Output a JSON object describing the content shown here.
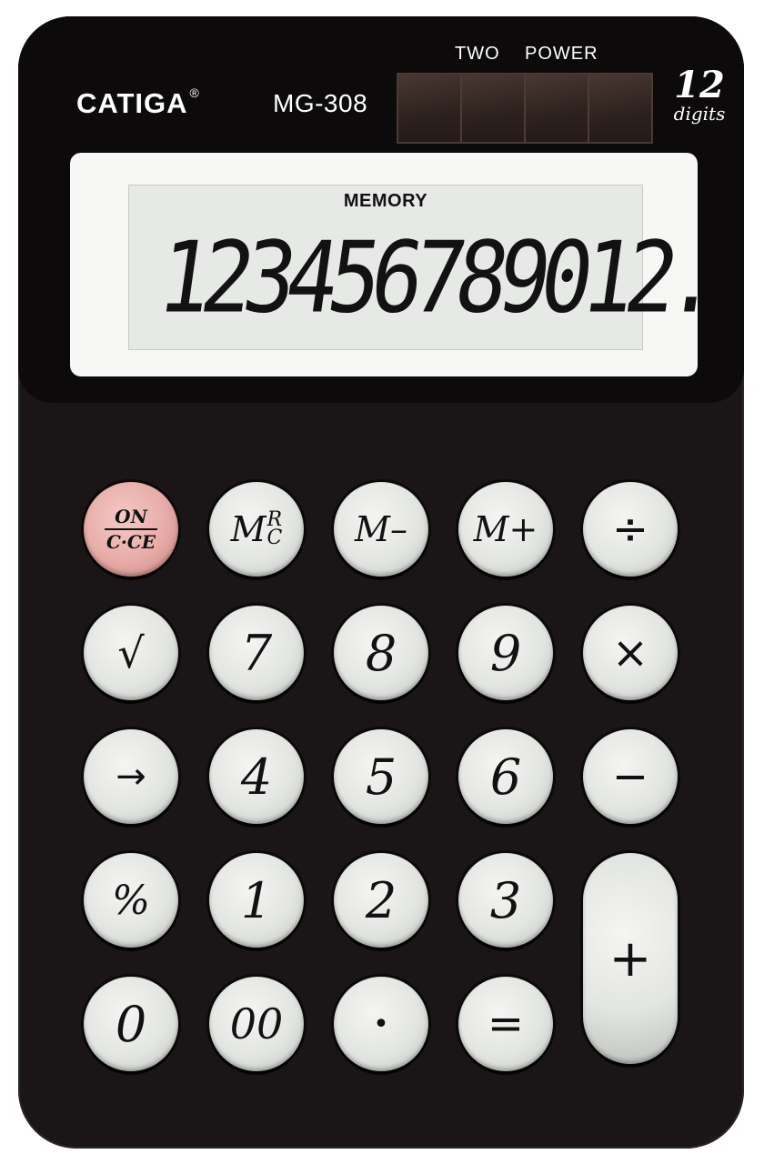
{
  "brand": {
    "name": "CATIGA",
    "registered": "®",
    "model": "MG-308",
    "power_two": "TWO",
    "power_word": "POWER",
    "digits_number": "12",
    "digits_word": "digits"
  },
  "display": {
    "memory_label": "MEMORY",
    "value": "123456789012."
  },
  "keys": {
    "on_top": "ON",
    "on_bottom": "C·CE",
    "mrc_m": "M",
    "mrc_r": "R",
    "mrc_c": "C",
    "m_minus": "M–",
    "m_plus": "M+",
    "divide": "÷",
    "sqrt": "√",
    "seven": "7",
    "eight": "8",
    "nine": "9",
    "multiply": "×",
    "shift": "→",
    "four": "4",
    "five": "5",
    "six": "6",
    "minus": "−",
    "percent": "%",
    "one": "1",
    "two": "2",
    "three": "3",
    "plus": "+",
    "zero": "0",
    "double_zero": "00",
    "decimal": "•",
    "equals": "="
  },
  "colors": {
    "body": "#1a1617",
    "key_face": "#e3e5e2",
    "on_key": "#e7aba7",
    "lcd": "#e7e9e7"
  }
}
